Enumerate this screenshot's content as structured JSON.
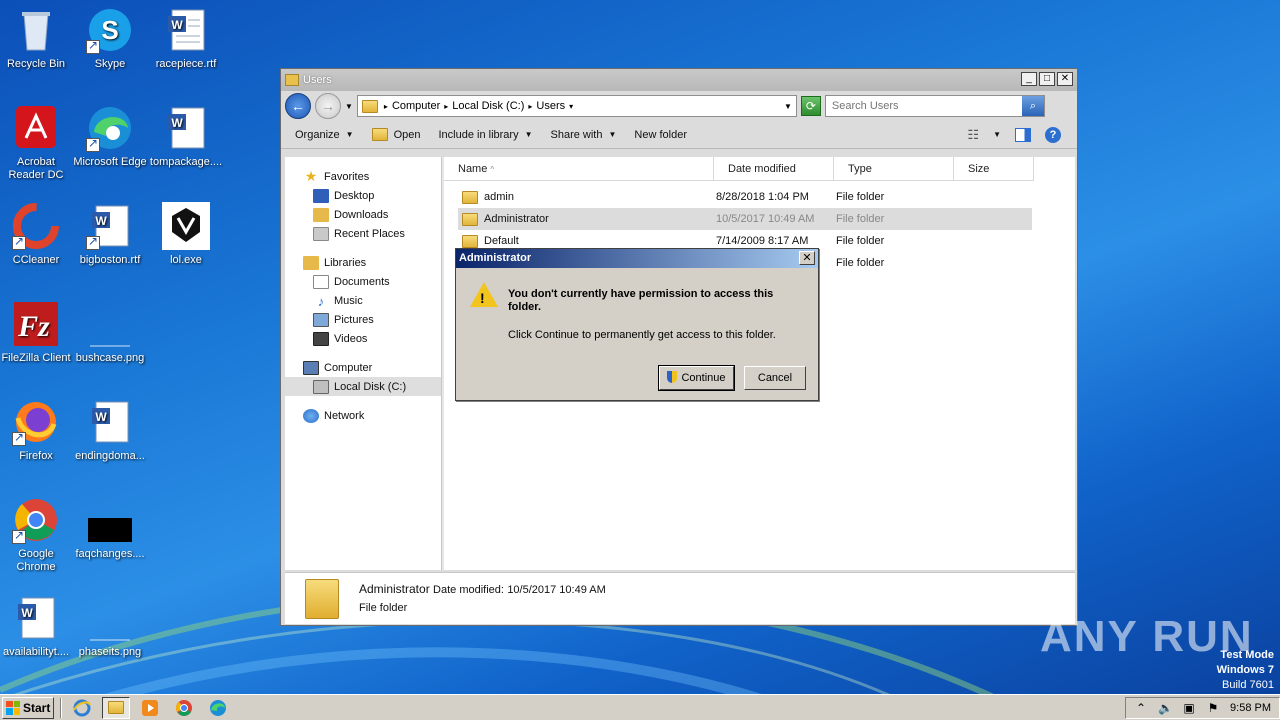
{
  "desktop": {
    "icons": [
      {
        "label": "Recycle Bin",
        "icon": "recycle-bin-icon"
      },
      {
        "label": "Skype",
        "icon": "skype-icon"
      },
      {
        "label": "racepiece.rtf",
        "icon": "word-doc-icon"
      },
      {
        "label": "Acrobat Reader DC",
        "icon": "acrobat-icon"
      },
      {
        "label": "Microsoft Edge",
        "icon": "edge-icon"
      },
      {
        "label": "tompackage....",
        "icon": "word-doc-icon"
      },
      {
        "label": "CCleaner",
        "icon": "ccleaner-icon"
      },
      {
        "label": "bigboston.rtf",
        "icon": "word-doc-icon"
      },
      {
        "label": "lol.exe",
        "icon": "exe-icon"
      },
      {
        "label": "FileZilla Client",
        "icon": "filezilla-icon"
      },
      {
        "label": "bushcase.png",
        "icon": "png-icon"
      },
      {
        "label": "Firefox",
        "icon": "firefox-icon"
      },
      {
        "label": "endingdoma...",
        "icon": "word-doc-icon"
      },
      {
        "label": "Google Chrome",
        "icon": "chrome-icon"
      },
      {
        "label": "faqchanges....",
        "icon": "png-icon"
      },
      {
        "label": "availabilityt....",
        "icon": "word-doc-icon"
      },
      {
        "label": "phaseits.png",
        "icon": "png-icon"
      }
    ]
  },
  "explorer": {
    "title": "Users",
    "breadcrumb": [
      "Computer",
      "Local Disk (C:)",
      "Users"
    ],
    "search_placeholder": "Search Users",
    "toolbar": {
      "organize": "Organize",
      "open": "Open",
      "include": "Include in library",
      "share": "Share with",
      "new_folder": "New folder"
    },
    "nav": {
      "favorites": "Favorites",
      "desktop": "Desktop",
      "downloads": "Downloads",
      "recent": "Recent Places",
      "libraries": "Libraries",
      "documents": "Documents",
      "music": "Music",
      "pictures": "Pictures",
      "videos": "Videos",
      "computer": "Computer",
      "local_disk": "Local Disk (C:)",
      "network": "Network"
    },
    "columns": {
      "name": "Name",
      "date": "Date modified",
      "type": "Type",
      "size": "Size"
    },
    "files": [
      {
        "name": "admin",
        "date": "8/28/2018 1:04 PM",
        "type": "File folder"
      },
      {
        "name": "Administrator",
        "date": "10/5/2017 10:49 AM",
        "type": "File folder"
      },
      {
        "name": "Default",
        "date": "7/14/2009 8:17 AM",
        "type": "File folder"
      },
      {
        "name": "",
        "date": "",
        "type": "File folder"
      }
    ],
    "status": {
      "name": "Administrator",
      "date_label": "Date modified:",
      "date_value": "10/5/2017 10:49 AM",
      "type": "File folder"
    }
  },
  "dialog": {
    "title": "Administrator",
    "message": "You don't currently have permission to access this folder.",
    "sub": "Click Continue to permanently get access to this folder.",
    "continue": "Continue",
    "cancel": "Cancel"
  },
  "watermark": "ANY RUN",
  "testmode": {
    "line1": "Test Mode",
    "line2": "Windows 7",
    "line3": "Build 7601"
  },
  "taskbar": {
    "start": "Start",
    "clock": "9:58 PM"
  }
}
